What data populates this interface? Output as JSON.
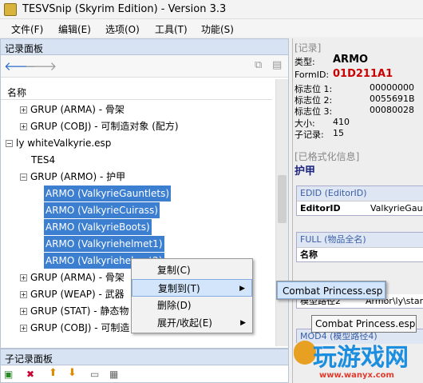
{
  "window": {
    "title": "TESVSnip (Skyrim Edition) - Version 3.3"
  },
  "menu": [
    "文件(F)",
    "编辑(E)",
    "选项(O)",
    "工具(T)",
    "功能(S)"
  ],
  "left": {
    "pane_title": "记录面板",
    "tree_header": "名称",
    "nodes": [
      "GRUP (ARMA) - 骨架",
      "GRUP (COBJ) - 可制造对象 (配方)",
      "ly whiteValkyrie.esp",
      "TES4",
      "GRUP (ARMO) - 护甲",
      "ARMO (ValkyrieGauntlets)",
      "ARMO (ValkyrieCuirass)",
      "ARMO (ValkyrieBoots)",
      "ARMO (Valkyriehelmet1)",
      "ARMO (Valkyriehelmet2)",
      "GRUP (ARMA) - 骨架",
      "GRUP (WEAP) - 武器",
      "GRUP (STAT) - 静态物",
      "GRUP (COBJ) - 可制造"
    ]
  },
  "bottom": {
    "pane_title": "子记录面板"
  },
  "right": {
    "record_header": "[记录]",
    "rows": [
      {
        "k": "类型:",
        "v": "ARMO"
      },
      {
        "k": "FormID:",
        "v": "01D211A1"
      },
      {
        "k": "标志位 1:",
        "v": "00000000"
      },
      {
        "k": "标志位 2:",
        "v": "0055691B"
      },
      {
        "k": "标志位 3:",
        "v": "00080028"
      },
      {
        "k": "大小:",
        "v": "410"
      },
      {
        "k": "子记录:",
        "v": "15"
      }
    ],
    "formatted_header": "[已格式化信息]",
    "formatted_value": "护甲",
    "edid_header": "EDID (EditorID)",
    "edid_key": "EditorID",
    "edid_value": "ValkyrieGaunt",
    "full_header": "FULL (物品全名)",
    "full_key": "名称",
    "model_key": "模型路径2",
    "model_value": "Armor\\ly\\stand",
    "mod4_header": "MOD4 (模型路径4)"
  },
  "context_menu": {
    "items": [
      "复制(C)",
      "复制到(T)",
      "删除(D)",
      "展开/收起(E)"
    ],
    "submenu_item": "Combat Princess.esp"
  },
  "tooltip": "Combat Princess.esp",
  "watermark": {
    "main": "玩游戏网",
    "sub": "www.wanyx.com"
  }
}
